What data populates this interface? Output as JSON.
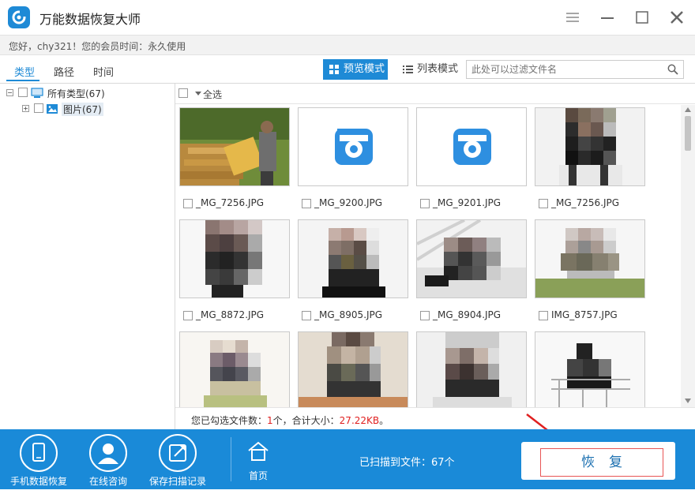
{
  "app": {
    "title": "万能数据恢复大师"
  },
  "info": {
    "text": "您好，chy321！您的会员时间：永久使用"
  },
  "tabs": [
    {
      "label": "类型"
    },
    {
      "label": "路径"
    },
    {
      "label": "时间"
    }
  ],
  "view_modes": {
    "preview": "预览模式",
    "list": "列表模式"
  },
  "search": {
    "placeholder": "此处可以过滤文件名"
  },
  "tree": {
    "root": "所有类型(67)",
    "child": "图片(67)"
  },
  "select_all": "全选",
  "files": [
    {
      "name": "_MG_7256.JPG"
    },
    {
      "name": "_MG_9200.JPG"
    },
    {
      "name": "_MG_9201.JPG"
    },
    {
      "name": "_MG_7256.JPG"
    },
    {
      "name": "_MG_8872.JPG"
    },
    {
      "name": "_MG_8905.JPG"
    },
    {
      "name": "_MG_8904.JPG"
    },
    {
      "name": "IMG_8757.JPG"
    }
  ],
  "status": {
    "prefix": "您已勾选文件数：",
    "count": "1",
    "mid": "个，合计大小：",
    "size": "27.22KB",
    "suffix": "。"
  },
  "bottom": {
    "phone": "手机数据恢复",
    "consult": "在线咨询",
    "save": "保存扫描记录",
    "home": "首页",
    "scanned": "已扫描到文件：67个",
    "recover": "恢复"
  },
  "colors": {
    "accent": "#1e8ad6",
    "bottom_bar": "#1a8ad8",
    "highlight": "#e02020"
  }
}
